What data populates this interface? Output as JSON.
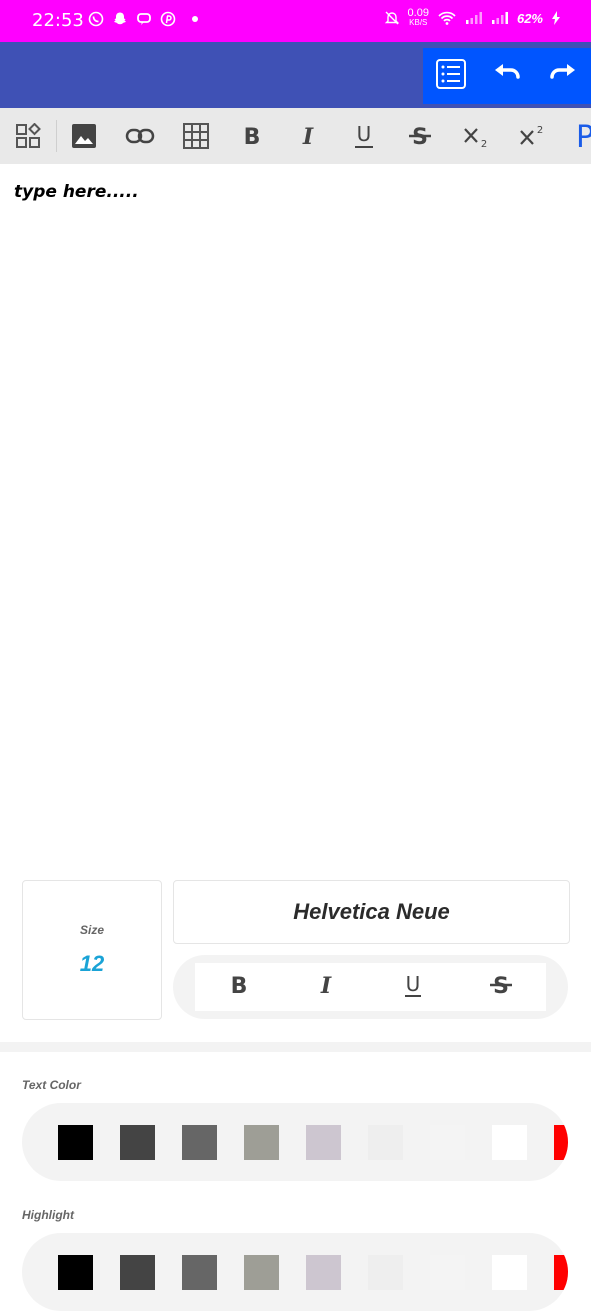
{
  "status_bar": {
    "time": "22:53",
    "net_speed_value": "0.09",
    "net_speed_unit": "KB/S",
    "battery": "62%"
  },
  "app_bar": {
    "actions": [
      "list-icon",
      "undo-icon",
      "redo-icon"
    ]
  },
  "toolbar": {
    "tools": [
      "widgets-icon",
      "image-icon",
      "link-icon",
      "table-icon",
      "bold-icon",
      "italic-icon",
      "underline-icon",
      "strikethrough-icon",
      "subscript-icon",
      "superscript-icon",
      "paragraph-icon"
    ]
  },
  "editor": {
    "placeholder": "type here....."
  },
  "format_panel": {
    "size_label": "Size",
    "size_value": "12",
    "font_name": "Helvetica Neue",
    "styles": [
      "B",
      "I",
      "U",
      "S"
    ],
    "text_color_label": "Text Color",
    "highlight_label": "Highlight",
    "colors": [
      "#000000",
      "#444444",
      "#666666",
      "#9e9e96",
      "#cdc6d0",
      "#eeeeee",
      "#f4f4f4",
      "#ffffff",
      "#ff0000"
    ]
  }
}
